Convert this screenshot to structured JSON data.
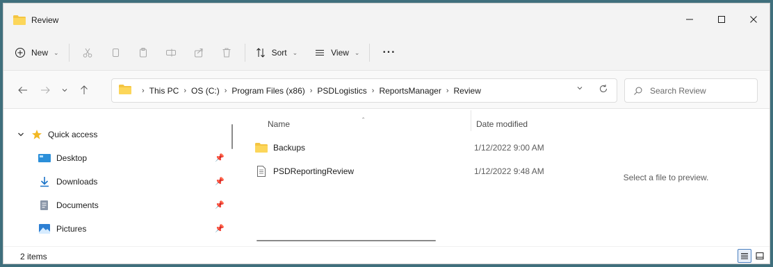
{
  "window": {
    "title": "Review",
    "controls": {
      "minimize": "—",
      "maximize": "☐",
      "close": "✕"
    }
  },
  "toolbar": {
    "new_label": "New",
    "sort_label": "Sort",
    "view_label": "View",
    "more_label": "···"
  },
  "address": {
    "breadcrumbs": [
      "This PC",
      "OS (C:)",
      "Program Files (x86)",
      "PSDLogistics",
      "ReportsManager",
      "Review"
    ],
    "search_placeholder": "Search Review"
  },
  "sidebar": {
    "quick_access_label": "Quick access",
    "items": [
      {
        "label": "Desktop",
        "icon": "desktop-icon"
      },
      {
        "label": "Downloads",
        "icon": "downloads-icon"
      },
      {
        "label": "Documents",
        "icon": "documents-icon"
      },
      {
        "label": "Pictures",
        "icon": "pictures-icon"
      }
    ]
  },
  "files": {
    "columns": {
      "name": "Name",
      "date": "Date modified"
    },
    "rows": [
      {
        "name": "Backups",
        "date": "1/12/2022 9:00 AM",
        "icon": "folder-icon"
      },
      {
        "name": "PSDReportingReview",
        "date": "1/12/2022 9:48 AM",
        "icon": "file-icon"
      }
    ]
  },
  "preview": {
    "message": "Select a file to preview."
  },
  "status": {
    "item_count": "2 items"
  },
  "colors": {
    "folder": "#f4c542",
    "accent": "#0067c0",
    "background": "#3f6f7c"
  }
}
